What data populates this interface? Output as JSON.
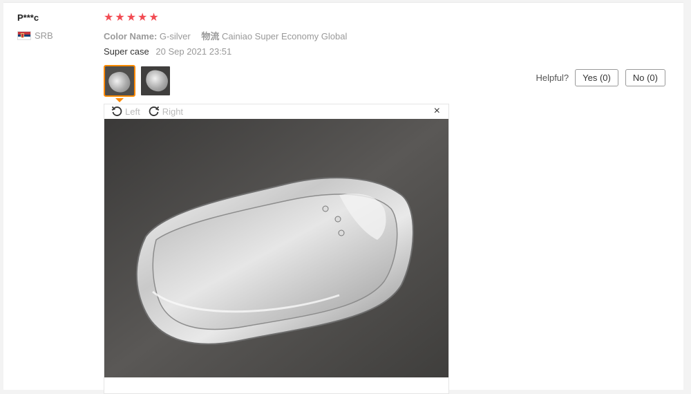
{
  "reviewer": {
    "name": "P***c",
    "country": "SRB"
  },
  "rating": {
    "stars": 5,
    "max": 5
  },
  "attributes": [
    {
      "key": "Color Name:",
      "value": "G-silver"
    },
    {
      "key": "物流",
      "value": "Cainiao Super Economy Global"
    }
  ],
  "review": {
    "text": "Super case",
    "date": "20 Sep 2021 23:51"
  },
  "helpful": {
    "label": "Helpful?",
    "yes": "Yes (0)",
    "no": "No (0)"
  },
  "viewer": {
    "rotate_left": "Left",
    "rotate_right": "Right",
    "close": "×"
  },
  "icons": [
    "serbia-flag-icon",
    "star-icon",
    "rotate-left-icon",
    "rotate-right-icon",
    "close-icon"
  ],
  "colors": {
    "star": "#f24b53",
    "active_thumb": "#ff8a00"
  }
}
